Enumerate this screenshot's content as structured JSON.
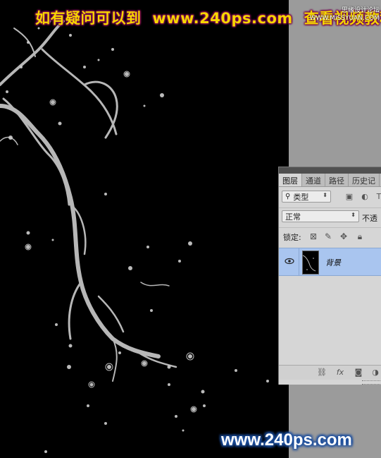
{
  "banner": {
    "left_text": "如有疑问可以到",
    "url": "www.240ps.com",
    "right_text": "查看视频教程"
  },
  "corner_mark": {
    "line1": "思缘设计论坛",
    "line2": "WWW.MISSYUAN.COM"
  },
  "watermark": "www.240ps.com",
  "layers_panel": {
    "tabs": [
      {
        "label": "图层",
        "active": true
      },
      {
        "label": "通道",
        "active": false
      },
      {
        "label": "路径",
        "active": false
      },
      {
        "label": "历史记",
        "active": false
      }
    ],
    "filter_kind_label": "类型",
    "blend_mode": "正常",
    "opacity_label": "不透",
    "lock_label": "锁定:",
    "layer": {
      "name": "背景",
      "visible": true,
      "selected": true
    },
    "footer_icons": [
      "link-icon",
      "fx-icon",
      "mask-icon",
      "adjustment-icon"
    ]
  },
  "colors": {
    "canvas_bg": "#000000",
    "pasteboard_bg": "#9b9b9b",
    "banner_text": "#f7d600",
    "banner_outline": "#7a0a4e",
    "watermark_outline": "#1d4f9e",
    "selected_layer": "#a9c5ef"
  }
}
